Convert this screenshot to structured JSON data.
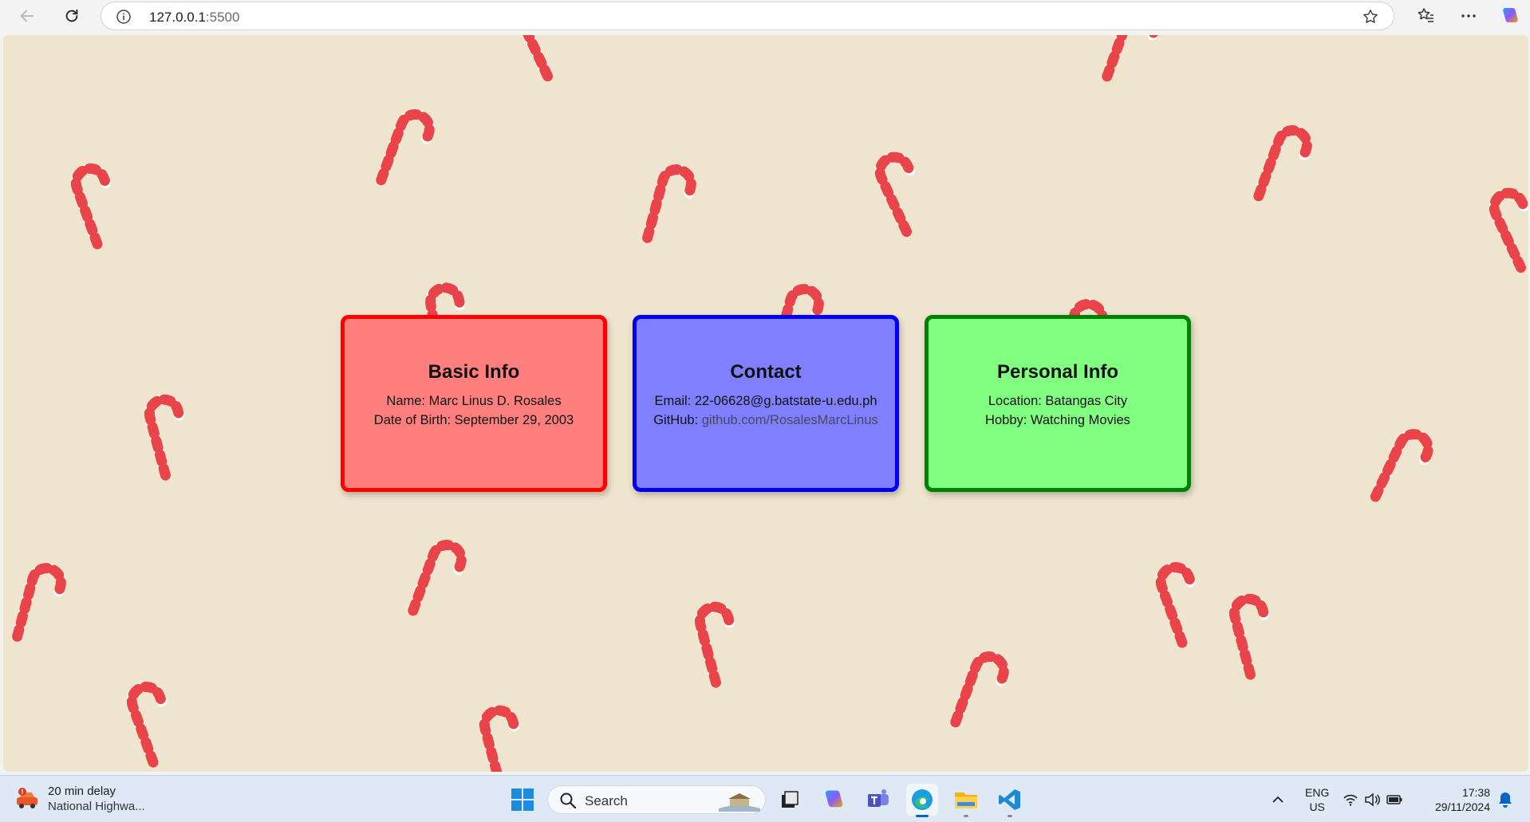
{
  "browser": {
    "url_host": "127.0.0.1",
    "url_port": ":5500"
  },
  "cards": [
    {
      "title": "Basic Info",
      "lines": [
        "Name: Marc Linus D. Rosales",
        "Date of Birth: September 29, 2003"
      ],
      "color": "#ff7f7f",
      "border": "#ff0000"
    },
    {
      "title": "Contact",
      "email_line": "Email: 22-06628@g.batstate-u.edu.ph",
      "github_label": "GitHub: ",
      "github_link": "github.com/RosalesMarcLinus",
      "color": "#7f7fff",
      "border": "#0000ee"
    },
    {
      "title": "Personal Info",
      "lines": [
        "Location: Batangas City",
        "Hobby: Watching Movies"
      ],
      "color": "#80ff80",
      "border": "#008000"
    }
  ],
  "taskbar": {
    "weather_title": "20 min delay",
    "weather_sub": "National Highwa...",
    "search_placeholder": "Search",
    "lang_top": "ENG",
    "lang_bottom": "US",
    "time": "17:38",
    "date": "29/11/2024"
  },
  "colors": {
    "page_background": "#efe5ce",
    "cane_red": "#e8444a"
  }
}
